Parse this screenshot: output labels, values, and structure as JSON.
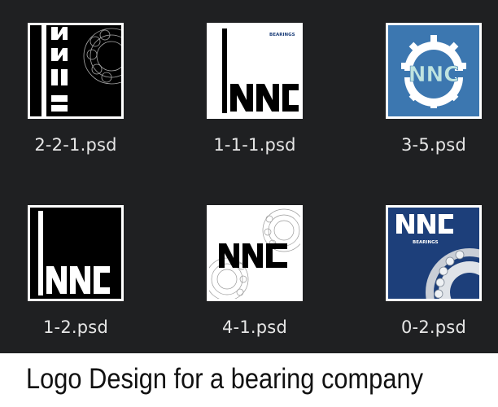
{
  "files": [
    {
      "name": "2-2-1.psd",
      "thumb_text": "NNC"
    },
    {
      "name": "1-1-1.psd",
      "thumb_text": "NNC",
      "thumb_subtext": "BEARINGS"
    },
    {
      "name": "3-5.psd",
      "thumb_text": "NNC"
    },
    {
      "name": "1-2.psd",
      "thumb_text": "NNC"
    },
    {
      "name": "4-1.psd",
      "thumb_text": "NNC"
    },
    {
      "name": "0-2.psd",
      "thumb_text": "NNC",
      "thumb_subtext": "BEARINGS"
    }
  ],
  "caption": "Logo Design for a bearing company",
  "colors": {
    "browser_bg": "#1f2022",
    "label": "#e6e6e6",
    "navy": "#1d3f7a",
    "steel_blue": "#3c77b0",
    "mint": "#bfe4e0"
  }
}
